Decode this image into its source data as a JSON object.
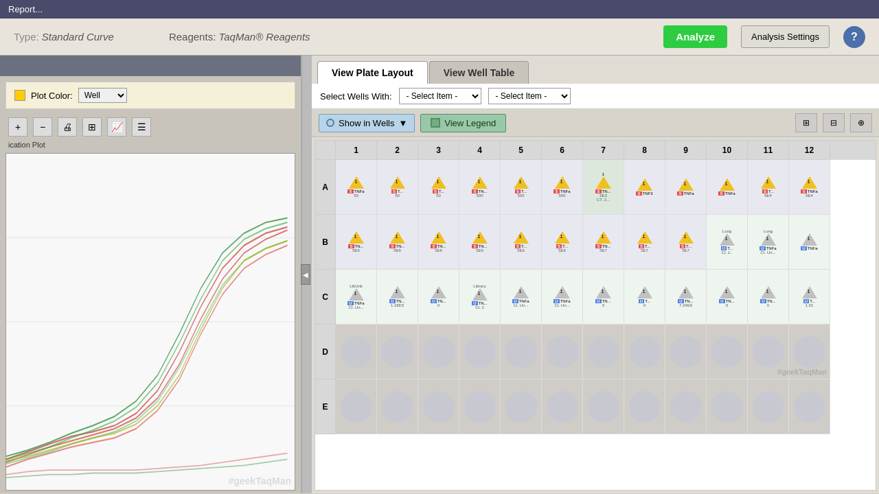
{
  "titleBar": {
    "text": "Report..."
  },
  "topBar": {
    "typeLabel": "Type:",
    "typeValue": "Standard Curve",
    "reagentsLabel": "Reagents:",
    "reagentsValue": "TaqMan® Reagents",
    "analyzeBtn": "Analyze",
    "analysisSettingsBtn": "Analysis Settings"
  },
  "leftPanel": {
    "plotColorLabel": "Plot Color:",
    "plotColorValue": "Well",
    "chartLabel": "ication Plot",
    "tools": [
      "+",
      "-",
      "🖨",
      "📋",
      "📈",
      "≡"
    ]
  },
  "tabs": [
    {
      "label": "View Plate Layout",
      "active": true
    },
    {
      "label": "View Well Table",
      "active": false
    }
  ],
  "wellsControls": {
    "label": "Select Wells With:",
    "dropdown1": "- Select Item -",
    "dropdown2": "- Select Item -"
  },
  "wellToolbar": {
    "showWells": "Show in Wells",
    "viewLegend": "View Legend"
  },
  "plate": {
    "colHeaders": [
      "",
      "1",
      "2",
      "3",
      "4",
      "5",
      "6",
      "7",
      "8",
      "9",
      "10",
      "11",
      "12"
    ],
    "rows": [
      {
        "label": "A",
        "wells": [
          {
            "type": "sample",
            "num": "1",
            "badge": "S",
            "line1": "TNFa",
            "line2": "50"
          },
          {
            "type": "sample",
            "num": "1",
            "badge": "S",
            "line1": "T...",
            "line2": "50"
          },
          {
            "type": "sample",
            "num": "1",
            "badge": "S",
            "line1": "T...",
            "line2": "50"
          },
          {
            "type": "sample",
            "num": "1",
            "badge": "S",
            "line1": "TN...",
            "line2": "500"
          },
          {
            "type": "sample",
            "num": "1",
            "badge": "S",
            "line1": "T...",
            "line2": "500"
          },
          {
            "type": "sample",
            "num": "1",
            "badge": "S",
            "line1": "TNFa",
            "line2": "500"
          },
          {
            "type": "special",
            "num": "1",
            "badge": "S",
            "line1": "TN...",
            "line2": "5E3",
            "extra": "CT. 2..."
          },
          {
            "type": "sample",
            "num": "1",
            "badge": "S",
            "line1": "TNF3",
            "line2": ""
          },
          {
            "type": "sample",
            "num": "1",
            "badge": "S",
            "line1": "TNFa",
            "line2": ""
          },
          {
            "type": "sample",
            "num": "1",
            "badge": "S",
            "line1": "TNFa",
            "line2": ""
          },
          {
            "type": "sample",
            "num": "1",
            "badge": "S",
            "line1": "T...",
            "line2": "6E4"
          },
          {
            "type": "sample",
            "num": "1",
            "badge": "S",
            "line1": "TNFa",
            "line2": "6E4"
          }
        ]
      },
      {
        "label": "B",
        "wells": [
          {
            "type": "sample",
            "num": "1",
            "badge": "S",
            "line1": "TN...",
            "line2": "5E6"
          },
          {
            "type": "sample",
            "num": "1",
            "badge": "S",
            "line1": "TN...",
            "line2": "5E6"
          },
          {
            "type": "sample",
            "num": "1",
            "badge": "S",
            "line1": "TN...",
            "line2": "5E6"
          },
          {
            "type": "sample",
            "num": "1",
            "badge": "S",
            "line1": "TN...",
            "line2": "5E6"
          },
          {
            "type": "sample",
            "num": "1",
            "badge": "S",
            "line1": "T...",
            "line2": "5E6"
          },
          {
            "type": "sample",
            "num": "1",
            "badge": "S",
            "line1": "T...",
            "line2": "5E6"
          },
          {
            "type": "sample",
            "num": "1",
            "badge": "S",
            "line1": "TN...",
            "line2": "5E7"
          },
          {
            "type": "sample",
            "num": "1",
            "badge": "S",
            "line1": "T...",
            "line2": "5E7"
          },
          {
            "type": "sample",
            "num": "1",
            "badge": "S",
            "line1": "T...",
            "line2": "5E7"
          },
          {
            "type": "unk",
            "num": "1",
            "badge": "U",
            "line1": "T...",
            "line2": "Ct. 2.."
          },
          {
            "type": "unk",
            "num": "1",
            "badge": "U",
            "line1": "TNFa",
            "line2": "Ct. Un..."
          },
          {
            "type": "unk",
            "num": "1",
            "badge": "U",
            "line1": "TNFa",
            "line2": ""
          }
        ]
      },
      {
        "label": "C",
        "wells": [
          {
            "type": "unk",
            "num": "1",
            "badge": "U",
            "line1": "TNFa",
            "line2": "Ct. Un..."
          },
          {
            "type": "unk",
            "num": "1",
            "badge": "U",
            "line1": "TN...",
            "line2": "1.18E5"
          },
          {
            "type": "unk",
            "num": "1",
            "badge": "U",
            "line1": "TN...",
            "line2": "0"
          },
          {
            "type": "libunk",
            "num": "1",
            "badge": "U",
            "line1": "TN...",
            "line2": "Ct. 2"
          },
          {
            "type": "unk",
            "num": "1",
            "badge": "U",
            "line1": "TNFa",
            "line2": "Ct. Un..."
          },
          {
            "type": "unk",
            "num": "1",
            "badge": "U",
            "line1": "TNFa",
            "line2": "Ct. Un..."
          },
          {
            "type": "unk",
            "num": "1",
            "badge": "U",
            "line1": "TN...",
            "line2": "0"
          },
          {
            "type": "unk",
            "num": "1",
            "badge": "U",
            "line1": "T...",
            "line2": "0"
          },
          {
            "type": "unk",
            "num": "1",
            "badge": "U",
            "line1": "TN...",
            "line2": "7.24E6"
          },
          {
            "type": "unk",
            "num": "1",
            "badge": "U",
            "line1": "TN...",
            "line2": "0"
          },
          {
            "type": "unk",
            "num": "1",
            "badge": "U",
            "line1": "TN...",
            "line2": "0"
          },
          {
            "type": "unk",
            "num": "1",
            "badge": "U",
            "line1": "T...",
            "line2": "1.01"
          }
        ]
      },
      {
        "label": "D",
        "wells": [
          {
            "type": "empty"
          },
          {
            "type": "empty"
          },
          {
            "type": "empty"
          },
          {
            "type": "empty"
          },
          {
            "type": "empty"
          },
          {
            "type": "empty"
          },
          {
            "type": "empty"
          },
          {
            "type": "empty"
          },
          {
            "type": "empty"
          },
          {
            "type": "empty"
          },
          {
            "type": "empty"
          },
          {
            "type": "empty"
          }
        ]
      },
      {
        "label": "E",
        "wells": [
          {
            "type": "empty"
          },
          {
            "type": "empty"
          },
          {
            "type": "empty"
          },
          {
            "type": "empty"
          },
          {
            "type": "empty"
          },
          {
            "type": "empty"
          },
          {
            "type": "empty"
          },
          {
            "type": "empty"
          },
          {
            "type": "empty"
          },
          {
            "type": "empty"
          },
          {
            "type": "empty"
          },
          {
            "type": "empty"
          }
        ]
      }
    ]
  },
  "watermark": "#geekTaqMan"
}
